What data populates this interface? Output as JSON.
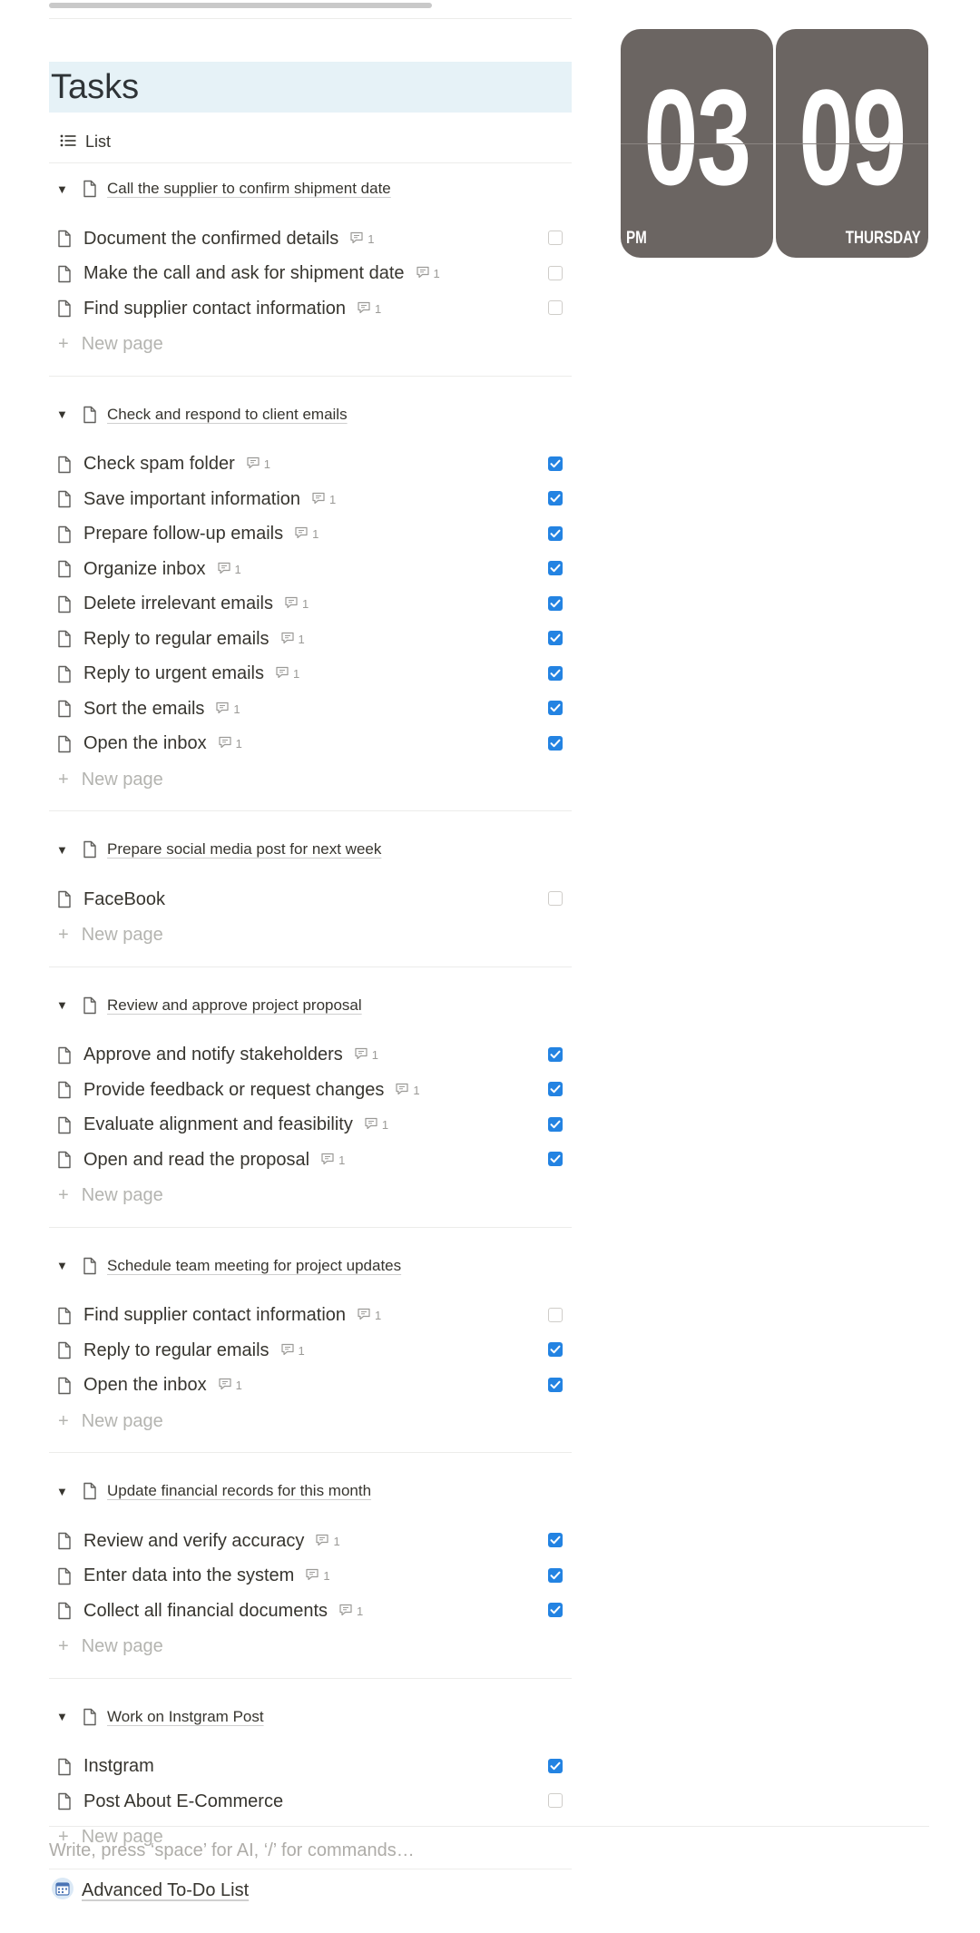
{
  "database": {
    "title": "Tasks",
    "view_label": "List",
    "new_page_label": "New page"
  },
  "groups": [
    {
      "title": "Call the supplier to confirm shipment date",
      "items": [
        {
          "title": "Document the confirmed details",
          "comments": "1",
          "done": false
        },
        {
          "title": "Make the call and ask for shipment date",
          "comments": "1",
          "done": false
        },
        {
          "title": "Find supplier contact information",
          "comments": "1",
          "done": false
        }
      ]
    },
    {
      "title": "Check and respond to client emails",
      "items": [
        {
          "title": "Check spam folder",
          "comments": "1",
          "done": true
        },
        {
          "title": "Save important information",
          "comments": "1",
          "done": true
        },
        {
          "title": "Prepare follow-up emails",
          "comments": "1",
          "done": true
        },
        {
          "title": "Organize inbox",
          "comments": "1",
          "done": true
        },
        {
          "title": "Delete irrelevant emails",
          "comments": "1",
          "done": true
        },
        {
          "title": "Reply to regular emails",
          "comments": "1",
          "done": true
        },
        {
          "title": "Reply to urgent emails",
          "comments": "1",
          "done": true
        },
        {
          "title": "Sort the emails",
          "comments": "1",
          "done": true
        },
        {
          "title": "Open the inbox",
          "comments": "1",
          "done": true
        }
      ]
    },
    {
      "title": "Prepare social media post for next week",
      "items": [
        {
          "title": "FaceBook",
          "comments": "",
          "done": false
        }
      ]
    },
    {
      "title": "Review and approve project proposal",
      "items": [
        {
          "title": "Approve and notify stakeholders",
          "comments": "1",
          "done": true
        },
        {
          "title": "Provide feedback or request changes",
          "comments": "1",
          "done": true
        },
        {
          "title": "Evaluate alignment and feasibility",
          "comments": "1",
          "done": true
        },
        {
          "title": "Open and read the proposal",
          "comments": "1",
          "done": true
        }
      ]
    },
    {
      "title": "Schedule team meeting for project updates",
      "items": [
        {
          "title": "Find supplier contact information",
          "comments": "1",
          "done": false
        },
        {
          "title": "Reply to regular emails",
          "comments": "1",
          "done": true
        },
        {
          "title": "Open the inbox",
          "comments": "1",
          "done": true
        }
      ]
    },
    {
      "title": "Update financial records for this month",
      "items": [
        {
          "title": "Review and verify accuracy",
          "comments": "1",
          "done": true
        },
        {
          "title": "Enter data into the system",
          "comments": "1",
          "done": true
        },
        {
          "title": "Collect all financial documents",
          "comments": "1",
          "done": true
        }
      ]
    },
    {
      "title": "Work on Instgram Post",
      "items": [
        {
          "title": "Instgram",
          "comments": "",
          "done": true
        },
        {
          "title": "Post About E-Commerce",
          "comments": "",
          "done": false
        }
      ]
    }
  ],
  "clock": {
    "hour": "03",
    "minute": "09",
    "period": "PM",
    "day": "THURSDAY",
    "card_color": "#6b6562"
  },
  "composer": {
    "placeholder": "Write, press ‘space’ for AI, ‘/’ for commands…"
  },
  "linked_page": {
    "icon": "calendar-icon",
    "title": "Advanced To-Do List"
  },
  "colors": {
    "checkbox_checked": "#2383e2",
    "header_bg": "#e6f2f7"
  }
}
